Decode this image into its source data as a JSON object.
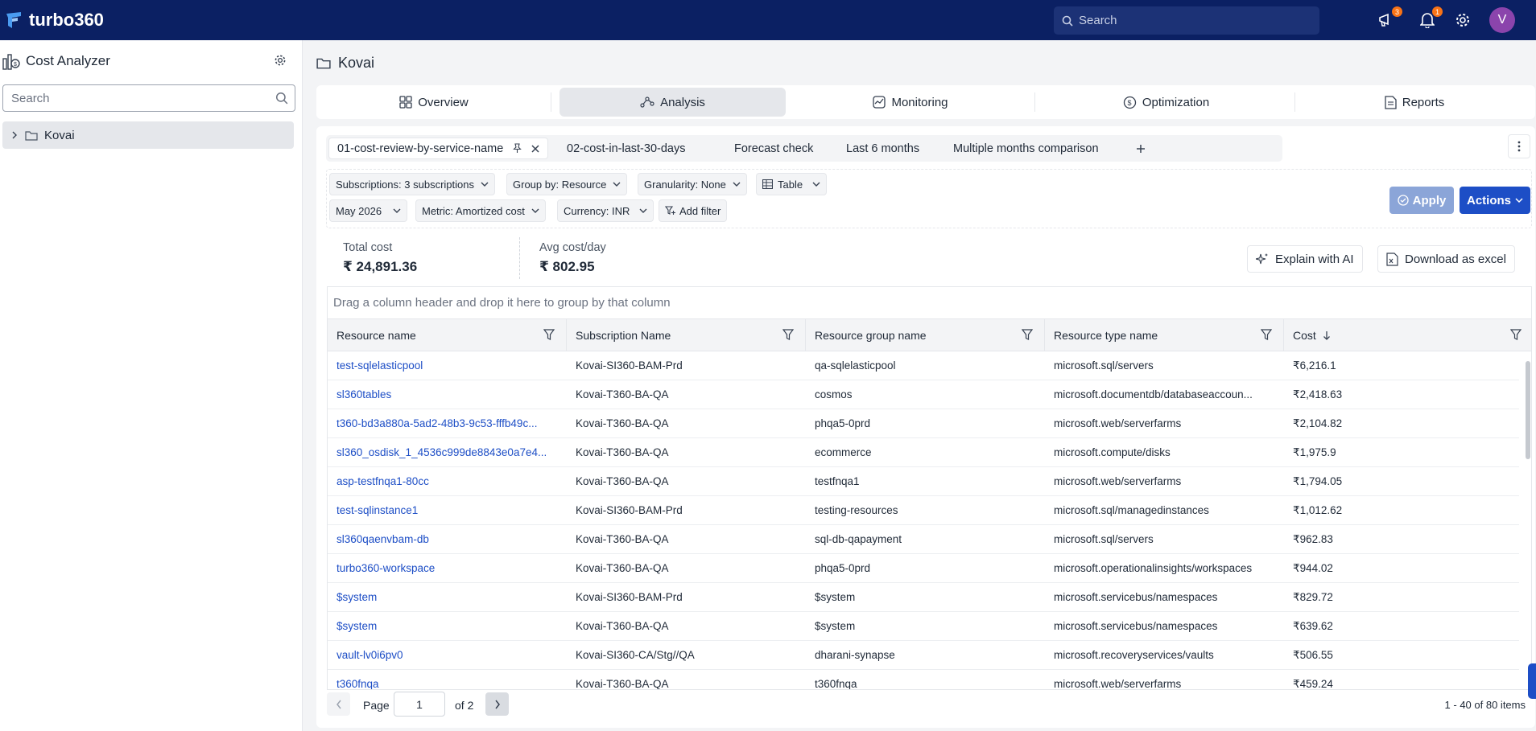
{
  "app": {
    "brand": "turbo360",
    "search_placeholder": "Search",
    "avatar_initial": "V",
    "announcement_count": "3",
    "notification_count": "1"
  },
  "sidebar": {
    "title": "Cost Analyzer",
    "search_placeholder": "Search",
    "tree_item": "Kovai"
  },
  "page": {
    "title": "Kovai"
  },
  "tabs": [
    "Overview",
    "Analysis",
    "Monitoring",
    "Optimization",
    "Reports"
  ],
  "active_tab": "Analysis",
  "views": [
    "01-cost-review-by-service-name",
    "02-cost-in-last-30-days",
    "Forecast check",
    "Last 6 months",
    "Multiple months comparison"
  ],
  "filters": {
    "subscriptions": "Subscriptions: 3 subscriptions",
    "group_by": "Group by: Resource",
    "granularity": "Granularity: None",
    "view_type": "Table",
    "month": "May 2026",
    "metric": "Metric: Amortized cost",
    "currency": "Currency: INR",
    "add_filter": "Add filter"
  },
  "buttons": {
    "apply": "Apply",
    "actions": "Actions",
    "explain_ai": "Explain with AI",
    "download_excel": "Download as excel"
  },
  "stats": {
    "total_label": "Total cost",
    "total_value": "₹ 24,891.36",
    "avg_label": "Avg cost/day",
    "avg_value": "₹ 802.95"
  },
  "grid": {
    "group_hint": "Drag a column header and drop it here to group by that column",
    "columns": [
      "Resource name",
      "Subscription Name",
      "Resource group name",
      "Resource type name",
      "Cost"
    ],
    "rows": [
      [
        "test-sqlelasticpool",
        "Kovai-SI360-BAM-Prd",
        "qa-sqlelasticpool",
        "microsoft.sql/servers",
        "₹6,216.1"
      ],
      [
        "sl360tables",
        "Kovai-T360-BA-QA",
        "cosmos",
        "microsoft.documentdb/databaseaccoun...",
        "₹2,418.63"
      ],
      [
        "t360-bd3a880a-5ad2-48b3-9c53-fffb49c...",
        "Kovai-T360-BA-QA",
        "phqa5-0prd",
        "microsoft.web/serverfarms",
        "₹2,104.82"
      ],
      [
        "sl360_osdisk_1_4536c999de8843e0a7e4...",
        "Kovai-T360-BA-QA",
        "ecommerce",
        "microsoft.compute/disks",
        "₹1,975.9"
      ],
      [
        "asp-testfnqa1-80cc",
        "Kovai-T360-BA-QA",
        "testfnqa1",
        "microsoft.web/serverfarms",
        "₹1,794.05"
      ],
      [
        "test-sqlinstance1",
        "Kovai-SI360-BAM-Prd",
        "testing-resources",
        "microsoft.sql/managedinstances",
        "₹1,012.62"
      ],
      [
        "sl360qaenvbam-db",
        "Kovai-T360-BA-QA",
        "sql-db-qapayment",
        "microsoft.sql/servers",
        "₹962.83"
      ],
      [
        "turbo360-workspace",
        "Kovai-T360-BA-QA",
        "phqa5-0prd",
        "microsoft.operationalinsights/workspaces",
        "₹944.02"
      ],
      [
        "$system",
        "Kovai-SI360-BAM-Prd",
        "$system",
        "microsoft.servicebus/namespaces",
        "₹829.72"
      ],
      [
        "$system",
        "Kovai-T360-BA-QA",
        "$system",
        "microsoft.servicebus/namespaces",
        "₹639.62"
      ],
      [
        "vault-lv0i6pv0",
        "Kovai-SI360-CA/Stg//QA",
        "dharani-synapse",
        "microsoft.recoveryservices/vaults",
        "₹506.55"
      ],
      [
        "t360fnqa",
        "Kovai-T360-BA-QA",
        "t360fnqa",
        "microsoft.web/serverfarms",
        "₹459.24"
      ]
    ]
  },
  "pager": {
    "page_label": "Page",
    "page_value": "1",
    "of_label": "of 2",
    "info": "1 - 40 of 80 items"
  }
}
